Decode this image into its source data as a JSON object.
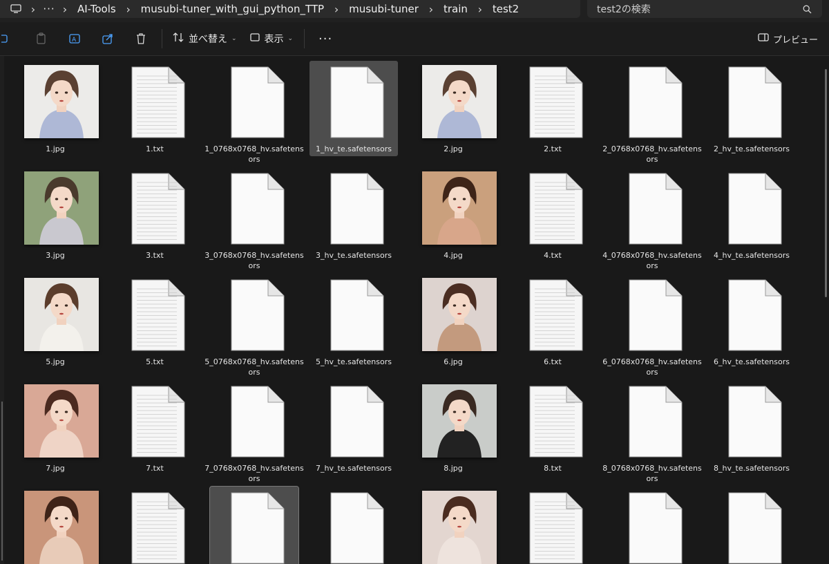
{
  "breadcrumb": {
    "items": [
      "AI-Tools",
      "musubi-tuner_with_gui_python_TTP",
      "musubi-tuner",
      "train",
      "test2"
    ]
  },
  "search": {
    "placeholder": "test2の検索"
  },
  "toolbar": {
    "sort_label": "並べ替え",
    "view_label": "表示",
    "preview_label": "プレビュー"
  },
  "files": [
    {
      "name": "1.jpg",
      "type": "image",
      "palette": [
        "#ecebe9",
        "#aeb8d6",
        "#5a4032"
      ]
    },
    {
      "name": "1.txt",
      "type": "text"
    },
    {
      "name": "1_0768x0768_hv.safetensors",
      "type": "blank"
    },
    {
      "name": "1_hv_te.safetensors",
      "type": "blank",
      "state": "selected"
    },
    {
      "name": "2.jpg",
      "type": "image",
      "palette": [
        "#ecebe9",
        "#aeb8d6",
        "#5a4032"
      ]
    },
    {
      "name": "2.txt",
      "type": "text"
    },
    {
      "name": "2_0768x0768_hv.safetensors",
      "type": "blank"
    },
    {
      "name": "2_hv_te.safetensors",
      "type": "blank"
    },
    {
      "name": "3.jpg",
      "type": "image",
      "palette": [
        "#8fa27a",
        "#c9c8cf",
        "#4a3a2c"
      ]
    },
    {
      "name": "3.txt",
      "type": "text"
    },
    {
      "name": "3_0768x0768_hv.safetensors",
      "type": "blank"
    },
    {
      "name": "3_hv_te.safetensors",
      "type": "blank"
    },
    {
      "name": "4.jpg",
      "type": "image",
      "palette": [
        "#caa07d",
        "#d8a68a",
        "#3e2418"
      ]
    },
    {
      "name": "4.txt",
      "type": "text"
    },
    {
      "name": "4_0768x0768_hv.safetensors",
      "type": "blank"
    },
    {
      "name": "4_hv_te.safetensors",
      "type": "blank"
    },
    {
      "name": "5.jpg",
      "type": "image",
      "palette": [
        "#e8e6e2",
        "#f3f1ec",
        "#5b3d2c"
      ]
    },
    {
      "name": "5.txt",
      "type": "text"
    },
    {
      "name": "5_0768x0768_hv.safetensors",
      "type": "blank"
    },
    {
      "name": "5_hv_te.safetensors",
      "type": "blank"
    },
    {
      "name": "6.jpg",
      "type": "image",
      "palette": [
        "#ddd3cf",
        "#c39a7e",
        "#4a2d22"
      ]
    },
    {
      "name": "6.txt",
      "type": "text"
    },
    {
      "name": "6_0768x0768_hv.safetensors",
      "type": "blank"
    },
    {
      "name": "6_hv_te.safetensors",
      "type": "blank"
    },
    {
      "name": "7.jpg",
      "type": "image",
      "palette": [
        "#d9a896",
        "#efd4c6",
        "#4b2a20"
      ]
    },
    {
      "name": "7.txt",
      "type": "text"
    },
    {
      "name": "7_0768x0768_hv.safetensors",
      "type": "blank"
    },
    {
      "name": "7_hv_te.safetensors",
      "type": "blank"
    },
    {
      "name": "8.jpg",
      "type": "image",
      "palette": [
        "#c9ccc9",
        "#222222",
        "#3a2a22"
      ]
    },
    {
      "name": "8.txt",
      "type": "text"
    },
    {
      "name": "8_0768x0768_hv.safetensors",
      "type": "blank"
    },
    {
      "name": "8_hv_te.safetensors",
      "type": "blank"
    },
    {
      "name": "",
      "type": "image",
      "palette": [
        "#c9957a",
        "#e8cbb8",
        "#3e2318"
      ]
    },
    {
      "name": "",
      "type": "text"
    },
    {
      "name": "",
      "type": "blank",
      "state": "outlined"
    },
    {
      "name": "",
      "type": "blank"
    },
    {
      "name": "",
      "type": "image",
      "palette": [
        "#e3d6d0",
        "#eee3dd",
        "#4a2c20"
      ]
    },
    {
      "name": "",
      "type": "text"
    },
    {
      "name": "",
      "type": "blank"
    },
    {
      "name": "",
      "type": "blank"
    }
  ]
}
